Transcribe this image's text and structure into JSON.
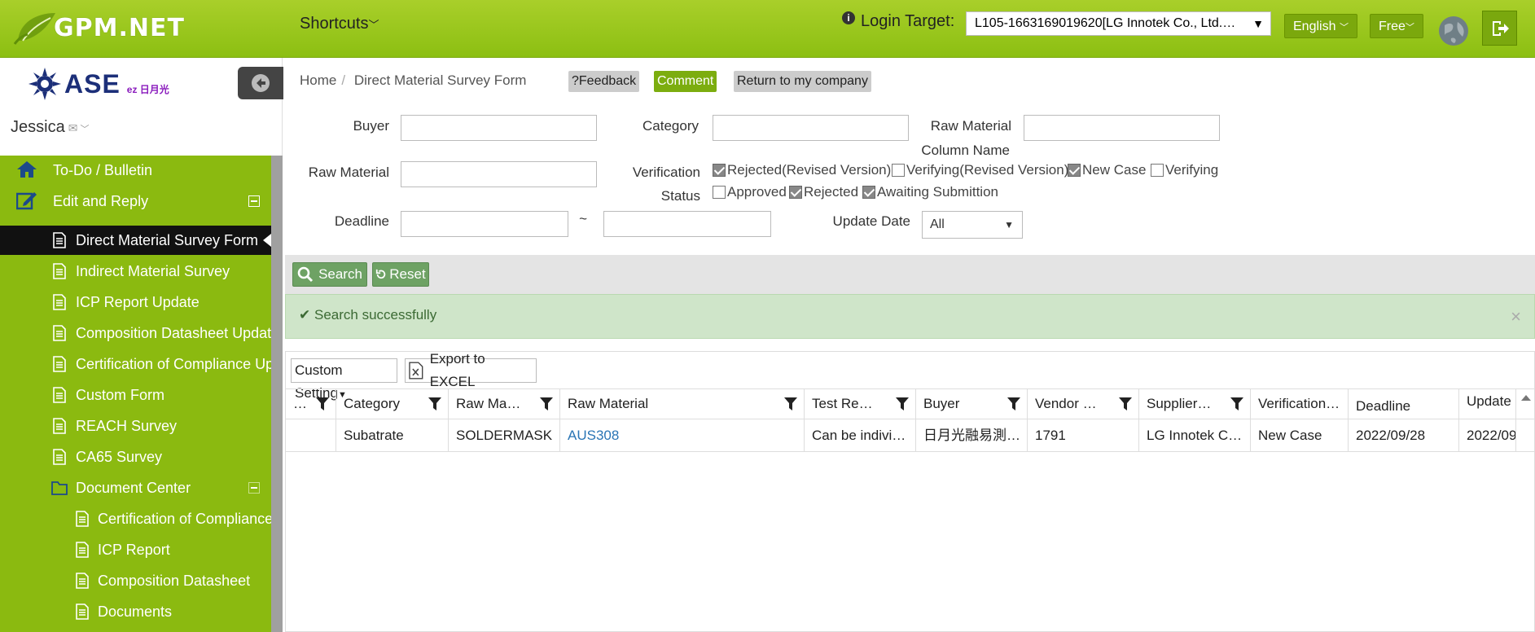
{
  "header": {
    "logo_text": "GPM.NET",
    "shortcuts_label": "Shortcuts",
    "login_target_label": "Login Target:",
    "login_target_value": "L105-1663169019620[LG Innotek Co., Ltd.…",
    "language": "English",
    "plan": "Free"
  },
  "sidebar": {
    "brand_name": "ASE",
    "brand_sub": "ez 日月光",
    "user_name": "Jessica",
    "items": [
      {
        "label": "To-Do / Bulletin",
        "icon": "home-icon"
      },
      {
        "label": "Edit and Reply",
        "icon": "edit-icon"
      },
      {
        "label": "Direct Material Survey Form",
        "icon": "document-icon"
      },
      {
        "label": "Indirect Material Survey",
        "icon": "document-icon"
      },
      {
        "label": "ICP Report Update",
        "icon": "document-icon"
      },
      {
        "label": "Composition Datasheet Update",
        "icon": "document-icon"
      },
      {
        "label": "Certification of Compliance Upd",
        "icon": "document-icon"
      },
      {
        "label": "Custom Form",
        "icon": "document-icon"
      },
      {
        "label": "REACH Survey",
        "icon": "document-icon"
      },
      {
        "label": "CA65 Survey",
        "icon": "document-icon"
      },
      {
        "label": "Document Center",
        "icon": "folder-icon"
      },
      {
        "label": "Certification of Compliance",
        "icon": "document-icon"
      },
      {
        "label": "ICP Report",
        "icon": "document-icon"
      },
      {
        "label": "Composition Datasheet",
        "icon": "document-icon"
      },
      {
        "label": "Documents",
        "icon": "document-icon"
      }
    ]
  },
  "breadcrumb": {
    "home": "Home",
    "current": "Direct Material Survey Form"
  },
  "actions": {
    "feedback": "?Feedback",
    "comment": "Comment",
    "return": "Return to my company"
  },
  "filters": {
    "buyer_label": "Buyer",
    "buyer_value": "",
    "category_label": "Category",
    "category_value": "",
    "raw_material_column_label_1": "Raw Material",
    "raw_material_column_label_2": "Column Name",
    "raw_material_column_value": "",
    "raw_material_label": "Raw Material",
    "raw_material_value": "",
    "verification_label_1": "Verification",
    "verification_label_2": "Status",
    "statuses": [
      {
        "label": "Rejected(Revised Version)",
        "checked": true
      },
      {
        "label": "Verifying(Revised Version)",
        "checked": false
      },
      {
        "label": "New Case",
        "checked": true
      },
      {
        "label": "Verifying",
        "checked": false
      },
      {
        "label": "Approved",
        "checked": false
      },
      {
        "label": "Rejected",
        "checked": true
      },
      {
        "label": "Awaiting Submittion",
        "checked": true
      }
    ],
    "deadline_label": "Deadline",
    "deadline_from": "",
    "deadline_to": "",
    "range_sep": "~",
    "update_date_label": "Update Date",
    "update_date_value": "All",
    "search_button": "Search",
    "reset_button": "Reset"
  },
  "alert": {
    "message": "Search successfully",
    "close": "×"
  },
  "grid": {
    "custom_setting": "Custom Setting",
    "export_excel": "Export to EXCEL",
    "columns": [
      "…",
      "Category",
      "Raw Ma…",
      "Raw Material",
      "Test Re…",
      "Buyer",
      "Vendor …",
      "Supplier…",
      "Verification…",
      "Deadline",
      "Update"
    ],
    "rows": [
      [
        "",
        "Subatrate",
        "SOLDERMASK",
        "AUS308",
        "Can be indivi…",
        "日月光融易測…",
        "1791",
        "LG Innotek C…",
        "New Case",
        "2022/09/28",
        "2022/09"
      ]
    ]
  },
  "colors": {
    "header_green": "#8cbf12",
    "sidebar_green": "#8bba10",
    "active_item": "#111111",
    "alert_bg": "#cfe5c9",
    "link": "#2a75b5"
  }
}
